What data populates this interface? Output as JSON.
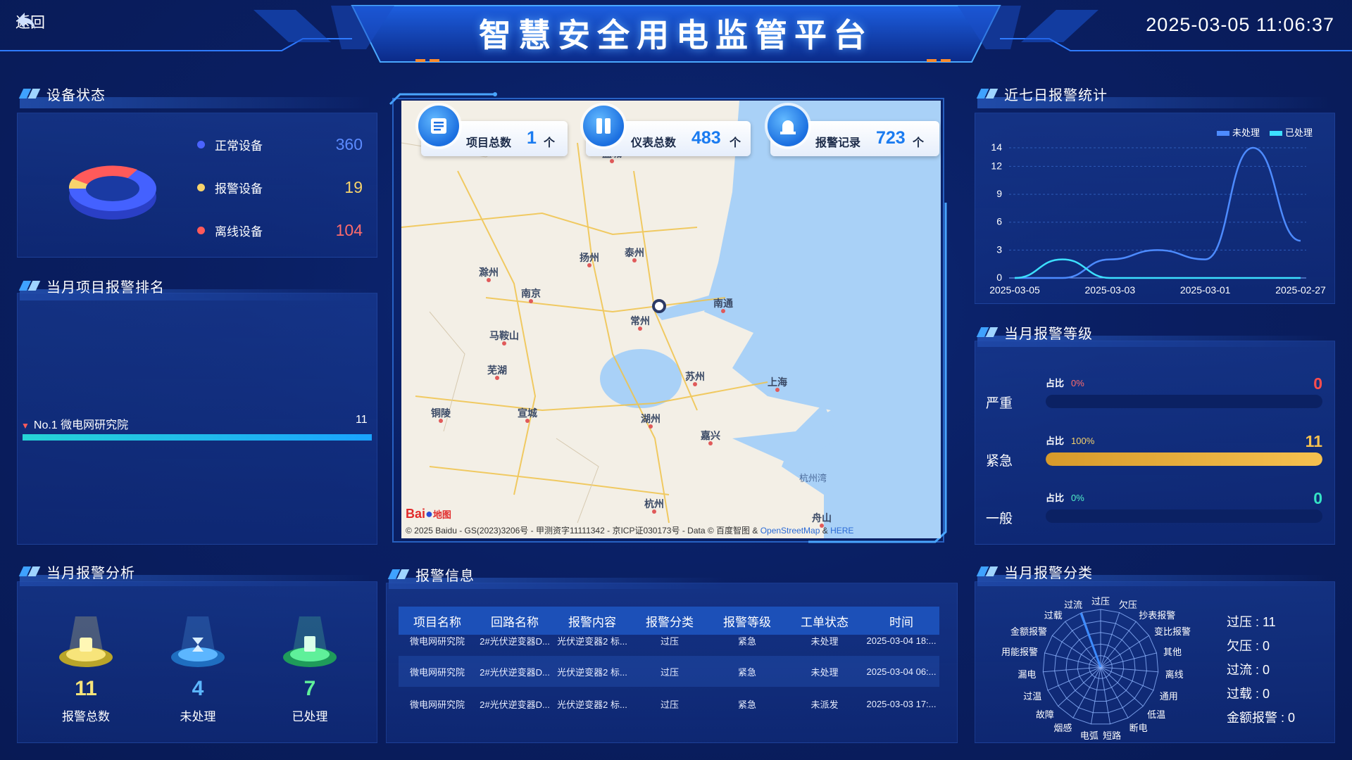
{
  "header": {
    "back_label": "返回",
    "title": "智慧安全用电监管平台",
    "datetime": "2025-03-05 11:06:37"
  },
  "device_status": {
    "title": "设备状态",
    "items": [
      {
        "name": "正常设备",
        "value": "360",
        "color": "#4a63ff"
      },
      {
        "name": "报警设备",
        "value": "19",
        "color": "#f7d36b"
      },
      {
        "name": "离线设备",
        "value": "104",
        "color": "#ff5a5a"
      }
    ]
  },
  "project_ranking": {
    "title": "当月项目报警排名",
    "items": [
      {
        "label": "No.1 微电网研究院",
        "value": "11",
        "fraction": 1.0
      }
    ]
  },
  "alarm_analysis": {
    "title": "当月报警分析",
    "items": [
      {
        "value": "11",
        "label": "报警总数",
        "color": "#f7e47a",
        "icon": "alarm-beacon-icon"
      },
      {
        "value": "4",
        "label": "未处理",
        "color": "#5cb6ff",
        "icon": "hourglass-icon"
      },
      {
        "value": "7",
        "label": "已处理",
        "color": "#5ff09a",
        "icon": "clipboard-check-icon"
      }
    ]
  },
  "map": {
    "cards": [
      {
        "label": "项目总数",
        "value": "1",
        "unit": "个",
        "icon": "list-icon"
      },
      {
        "label": "仪表总数",
        "value": "483",
        "unit": "个",
        "icon": "meter-icon"
      },
      {
        "label": "报警记录",
        "value": "723",
        "unit": "个",
        "icon": "siren-icon"
      }
    ],
    "cities": [
      "盐城",
      "扬州",
      "泰州",
      "滁州",
      "南京",
      "南通",
      "常州",
      "马鞍山",
      "芜湖",
      "苏州",
      "上海",
      "铜陵",
      "宣城",
      "湖州",
      "嘉兴",
      "杭州",
      "舟山"
    ],
    "sea_label": "杭州湾",
    "logo_text": "Bai",
    "logo_text_2": "地图",
    "copyright": "© 2025 Baidu - GS(2023)3206号 - 甲测资字11111342 - 京ICP证030173号 - Data © 百度智图 & ",
    "copyright_link_1": "OpenStreetMap",
    "copyright_amp": " & ",
    "copyright_link_2": "HERE"
  },
  "alarm_info": {
    "title": "报警信息",
    "columns": [
      "项目名称",
      "回路名称",
      "报警内容",
      "报警分类",
      "报警等级",
      "工单状态",
      "时间"
    ],
    "rows": [
      [
        "微电网研究院",
        "2#光伏逆变器D...",
        "光伏逆变器2 标...",
        "过压",
        "紧急",
        "未处理",
        "2025-03-04 18:..."
      ],
      [
        "微电网研究院",
        "2#光伏逆变器D...",
        "光伏逆变器2 标...",
        "过压",
        "紧急",
        "未处理",
        "2025-03-04 06:..."
      ],
      [
        "微电网研究院",
        "2#光伏逆变器D...",
        "光伏逆变器2 标...",
        "过压",
        "紧急",
        "未派发",
        "2025-03-03 17:..."
      ]
    ]
  },
  "weekly_stats": {
    "title": "近七日报警统计",
    "legend": [
      {
        "name": "未处理",
        "color": "#4d8bff"
      },
      {
        "name": "已处理",
        "color": "#3de0ff"
      }
    ]
  },
  "chart_data": {
    "type": "line",
    "x": [
      "2025-03-05",
      "2025-03-04",
      "2025-03-03",
      "2025-03-02",
      "2025-03-01",
      "2025-02-28",
      "2025-02-27"
    ],
    "x_tick_labels": [
      "2025-03-05",
      "2025-03-03",
      "2025-03-01",
      "2025-02-27"
    ],
    "y_tick_labels": [
      "0",
      "3",
      "6",
      "9",
      "12",
      "14"
    ],
    "ylim": [
      0,
      14
    ],
    "grid": true,
    "legend_position": "top-right",
    "series": [
      {
        "name": "未处理",
        "values": [
          0,
          0,
          2,
          3,
          2,
          14,
          4
        ]
      },
      {
        "name": "已处理",
        "values": [
          0,
          2,
          0,
          0,
          0,
          0,
          0
        ]
      }
    ]
  },
  "alarm_level": {
    "title": "当月报警等级",
    "items": [
      {
        "name": "严重",
        "pct_label": "占比",
        "pct": "0%",
        "value": "0",
        "fraction": 0,
        "color": "#ff4d4d",
        "pct_color": "#ff6b6b"
      },
      {
        "name": "紧急",
        "pct_label": "占比",
        "pct": "100%",
        "value": "11",
        "fraction": 1,
        "color": "#f6c14f",
        "pct_color": "#f6d36b"
      },
      {
        "name": "一般",
        "pct_label": "占比",
        "pct": "0%",
        "value": "0",
        "fraction": 0,
        "color": "#35e3c5",
        "pct_color": "#52f0c8"
      }
    ]
  },
  "alarm_class": {
    "title": "当月报警分类",
    "radar_labels": [
      "过压",
      "欠压",
      "抄表报警",
      "变比报警",
      "其他",
      "离线",
      "通用",
      "低温",
      "断电",
      "短路",
      "电弧",
      "烟感",
      "故障",
      "过温",
      "漏电",
      "用能报警",
      "金额报警",
      "过载",
      "过流"
    ],
    "stats": [
      {
        "label": "过压 : 11"
      },
      {
        "label": "欠压 : 0"
      },
      {
        "label": "过流 : 0"
      },
      {
        "label": "过载 : 0"
      },
      {
        "label": "金额报警 : 0"
      }
    ]
  }
}
